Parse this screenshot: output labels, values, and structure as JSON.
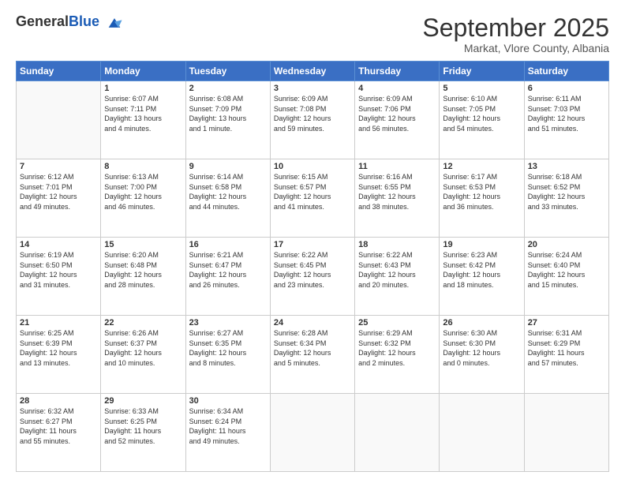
{
  "header": {
    "logo_general": "General",
    "logo_blue": "Blue",
    "month_title": "September 2025",
    "location": "Markat, Vlore County, Albania"
  },
  "days_of_week": [
    "Sunday",
    "Monday",
    "Tuesday",
    "Wednesday",
    "Thursday",
    "Friday",
    "Saturday"
  ],
  "weeks": [
    [
      {
        "day": "",
        "info": ""
      },
      {
        "day": "1",
        "info": "Sunrise: 6:07 AM\nSunset: 7:11 PM\nDaylight: 13 hours\nand 4 minutes."
      },
      {
        "day": "2",
        "info": "Sunrise: 6:08 AM\nSunset: 7:09 PM\nDaylight: 13 hours\nand 1 minute."
      },
      {
        "day": "3",
        "info": "Sunrise: 6:09 AM\nSunset: 7:08 PM\nDaylight: 12 hours\nand 59 minutes."
      },
      {
        "day": "4",
        "info": "Sunrise: 6:09 AM\nSunset: 7:06 PM\nDaylight: 12 hours\nand 56 minutes."
      },
      {
        "day": "5",
        "info": "Sunrise: 6:10 AM\nSunset: 7:05 PM\nDaylight: 12 hours\nand 54 minutes."
      },
      {
        "day": "6",
        "info": "Sunrise: 6:11 AM\nSunset: 7:03 PM\nDaylight: 12 hours\nand 51 minutes."
      }
    ],
    [
      {
        "day": "7",
        "info": "Sunrise: 6:12 AM\nSunset: 7:01 PM\nDaylight: 12 hours\nand 49 minutes."
      },
      {
        "day": "8",
        "info": "Sunrise: 6:13 AM\nSunset: 7:00 PM\nDaylight: 12 hours\nand 46 minutes."
      },
      {
        "day": "9",
        "info": "Sunrise: 6:14 AM\nSunset: 6:58 PM\nDaylight: 12 hours\nand 44 minutes."
      },
      {
        "day": "10",
        "info": "Sunrise: 6:15 AM\nSunset: 6:57 PM\nDaylight: 12 hours\nand 41 minutes."
      },
      {
        "day": "11",
        "info": "Sunrise: 6:16 AM\nSunset: 6:55 PM\nDaylight: 12 hours\nand 38 minutes."
      },
      {
        "day": "12",
        "info": "Sunrise: 6:17 AM\nSunset: 6:53 PM\nDaylight: 12 hours\nand 36 minutes."
      },
      {
        "day": "13",
        "info": "Sunrise: 6:18 AM\nSunset: 6:52 PM\nDaylight: 12 hours\nand 33 minutes."
      }
    ],
    [
      {
        "day": "14",
        "info": "Sunrise: 6:19 AM\nSunset: 6:50 PM\nDaylight: 12 hours\nand 31 minutes."
      },
      {
        "day": "15",
        "info": "Sunrise: 6:20 AM\nSunset: 6:48 PM\nDaylight: 12 hours\nand 28 minutes."
      },
      {
        "day": "16",
        "info": "Sunrise: 6:21 AM\nSunset: 6:47 PM\nDaylight: 12 hours\nand 26 minutes."
      },
      {
        "day": "17",
        "info": "Sunrise: 6:22 AM\nSunset: 6:45 PM\nDaylight: 12 hours\nand 23 minutes."
      },
      {
        "day": "18",
        "info": "Sunrise: 6:22 AM\nSunset: 6:43 PM\nDaylight: 12 hours\nand 20 minutes."
      },
      {
        "day": "19",
        "info": "Sunrise: 6:23 AM\nSunset: 6:42 PM\nDaylight: 12 hours\nand 18 minutes."
      },
      {
        "day": "20",
        "info": "Sunrise: 6:24 AM\nSunset: 6:40 PM\nDaylight: 12 hours\nand 15 minutes."
      }
    ],
    [
      {
        "day": "21",
        "info": "Sunrise: 6:25 AM\nSunset: 6:39 PM\nDaylight: 12 hours\nand 13 minutes."
      },
      {
        "day": "22",
        "info": "Sunrise: 6:26 AM\nSunset: 6:37 PM\nDaylight: 12 hours\nand 10 minutes."
      },
      {
        "day": "23",
        "info": "Sunrise: 6:27 AM\nSunset: 6:35 PM\nDaylight: 12 hours\nand 8 minutes."
      },
      {
        "day": "24",
        "info": "Sunrise: 6:28 AM\nSunset: 6:34 PM\nDaylight: 12 hours\nand 5 minutes."
      },
      {
        "day": "25",
        "info": "Sunrise: 6:29 AM\nSunset: 6:32 PM\nDaylight: 12 hours\nand 2 minutes."
      },
      {
        "day": "26",
        "info": "Sunrise: 6:30 AM\nSunset: 6:30 PM\nDaylight: 12 hours\nand 0 minutes."
      },
      {
        "day": "27",
        "info": "Sunrise: 6:31 AM\nSunset: 6:29 PM\nDaylight: 11 hours\nand 57 minutes."
      }
    ],
    [
      {
        "day": "28",
        "info": "Sunrise: 6:32 AM\nSunset: 6:27 PM\nDaylight: 11 hours\nand 55 minutes."
      },
      {
        "day": "29",
        "info": "Sunrise: 6:33 AM\nSunset: 6:25 PM\nDaylight: 11 hours\nand 52 minutes."
      },
      {
        "day": "30",
        "info": "Sunrise: 6:34 AM\nSunset: 6:24 PM\nDaylight: 11 hours\nand 49 minutes."
      },
      {
        "day": "",
        "info": ""
      },
      {
        "day": "",
        "info": ""
      },
      {
        "day": "",
        "info": ""
      },
      {
        "day": "",
        "info": ""
      }
    ]
  ]
}
